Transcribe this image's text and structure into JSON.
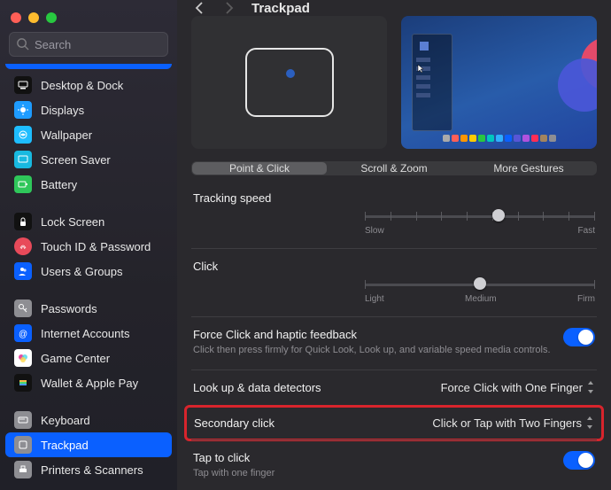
{
  "search": {
    "placeholder": "Search"
  },
  "header": {
    "title": "Trackpad"
  },
  "sidebar": {
    "items": [
      {
        "label": "Desktop & Dock"
      },
      {
        "label": "Displays"
      },
      {
        "label": "Wallpaper"
      },
      {
        "label": "Screen Saver"
      },
      {
        "label": "Battery"
      },
      {
        "label": "Lock Screen"
      },
      {
        "label": "Touch ID & Password"
      },
      {
        "label": "Users & Groups"
      },
      {
        "label": "Passwords"
      },
      {
        "label": "Internet Accounts"
      },
      {
        "label": "Game Center"
      },
      {
        "label": "Wallet & Apple Pay"
      },
      {
        "label": "Keyboard"
      },
      {
        "label": "Trackpad"
      },
      {
        "label": "Printers & Scanners"
      }
    ]
  },
  "tabs": {
    "point_click": "Point & Click",
    "scroll_zoom": "Scroll & Zoom",
    "more_gestures": "More Gestures"
  },
  "settings": {
    "tracking_speed": {
      "label": "Tracking speed",
      "min": "Slow",
      "max": "Fast"
    },
    "click": {
      "label": "Click",
      "min": "Light",
      "mid": "Medium",
      "max": "Firm"
    },
    "forceclick": {
      "label": "Force Click and haptic feedback",
      "desc": "Click then press firmly for Quick Look, Look up, and variable speed media controls."
    },
    "lookup": {
      "label": "Look up & data detectors",
      "value": "Force Click with One Finger"
    },
    "secondary": {
      "label": "Secondary click",
      "value": "Click or Tap with Two Fingers"
    },
    "tap": {
      "label": "Tap to click",
      "desc": "Tap with one finger"
    }
  }
}
